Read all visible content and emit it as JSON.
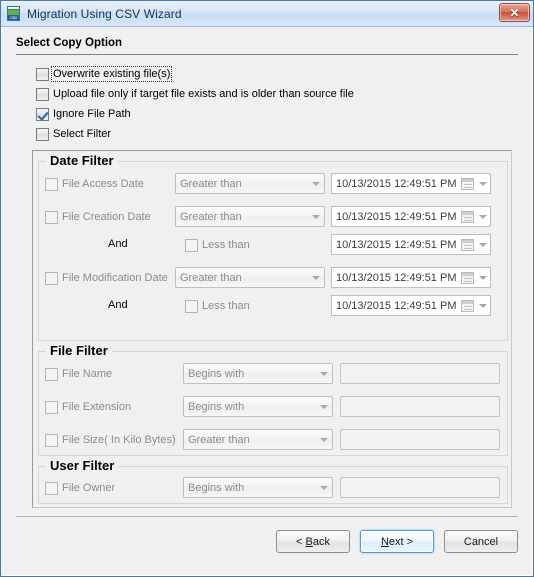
{
  "window": {
    "title": "Migration Using CSV Wizard",
    "icon": "csv-document-icon",
    "close_label": "✕"
  },
  "header": {
    "title": "Select Copy Option"
  },
  "options": [
    {
      "label": "Overwrite existing file(s)",
      "checked": false,
      "focused": true
    },
    {
      "label": "Upload file only if target file exists and is older than source file",
      "checked": false,
      "focused": false
    },
    {
      "label": "Ignore File Path",
      "checked": true,
      "focused": false
    },
    {
      "label": "Select Filter",
      "checked": false,
      "focused": false
    }
  ],
  "date_filter": {
    "title": "Date Filter",
    "and_label": "And",
    "rows": [
      {
        "label": "File Access Date",
        "checked": false,
        "operator": "Greater than",
        "date": "10/13/2015 12:49:51 PM"
      },
      {
        "label": "File Creation Date",
        "checked": false,
        "operator": "Greater than",
        "date": "10/13/2015 12:49:51 PM"
      },
      {
        "label": "Less than",
        "checked": false,
        "operator": null,
        "date": "10/13/2015 12:49:51 PM"
      },
      {
        "label": "File Modification Date",
        "checked": false,
        "operator": "Greater than",
        "date": "10/13/2015 12:49:51 PM"
      },
      {
        "label": "Less than",
        "checked": false,
        "operator": null,
        "date": "10/13/2015 12:49:51 PM"
      }
    ]
  },
  "file_filter": {
    "title": "File Filter",
    "rows": [
      {
        "label": "File Name",
        "checked": false,
        "operator": "Begins with",
        "value": ""
      },
      {
        "label": "File Extension",
        "checked": false,
        "operator": "Begins with",
        "value": ""
      },
      {
        "label": "File Size( In Kilo Bytes)",
        "checked": false,
        "operator": "Greater than",
        "value": ""
      }
    ]
  },
  "user_filter": {
    "title": "User Filter",
    "rows": [
      {
        "label": "File Owner",
        "checked": false,
        "operator": "Begins with",
        "value": ""
      }
    ]
  },
  "buttons": {
    "back": "< Back",
    "next": "Next >",
    "cancel": "Cancel"
  }
}
